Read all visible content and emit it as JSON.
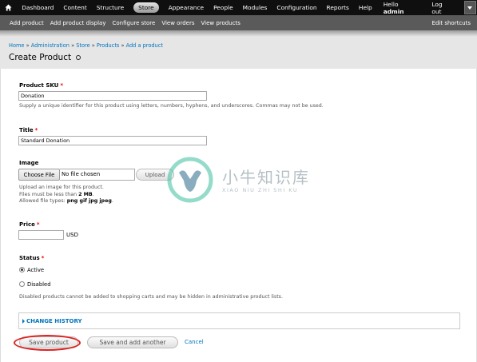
{
  "toolbar": {
    "items": [
      "Dashboard",
      "Content",
      "Structure",
      "Store",
      "Appearance",
      "People",
      "Modules",
      "Configuration",
      "Reports",
      "Help"
    ],
    "active": "Store",
    "hello_prefix": "Hello ",
    "user": "admin",
    "logout": "Log out"
  },
  "shortcuts": {
    "items": [
      "Add product",
      "Add product display",
      "Configure store",
      "View orders",
      "View products"
    ],
    "edit": "Edit shortcuts"
  },
  "breadcrumb": [
    "Home",
    "Administration",
    "Store",
    "Products",
    "Add a product"
  ],
  "page_title": "Create Product",
  "form": {
    "sku": {
      "label": "Product SKU",
      "required": "*",
      "value": "Donation",
      "description": "Supply a unique identifier for this product using letters, numbers, hyphens, and underscores. Commas may not be used."
    },
    "title": {
      "label": "Title",
      "required": "*",
      "value": "Standard Donation"
    },
    "image": {
      "label": "Image",
      "choose_file": "Choose File",
      "no_file": "No file chosen",
      "upload": "Upload",
      "desc1": "Upload an image for this product.",
      "desc2_prefix": "Files must be less than ",
      "desc2_size": "2 MB",
      "desc2_suffix": ".",
      "desc3_prefix": "Allowed file types: ",
      "desc3_types": "png gif jpg jpeg",
      "desc3_suffix": "."
    },
    "price": {
      "label": "Price",
      "required": "*",
      "value": "",
      "currency": "USD"
    },
    "status": {
      "label": "Status",
      "required": "*",
      "options": [
        "Active",
        "Disabled"
      ],
      "selected": "Active",
      "description": "Disabled products cannot be added to shopping carts and may be hidden in administrative product lists."
    },
    "change_history": "CHANGE HISTORY",
    "buttons": {
      "save": "Save product",
      "save_add": "Save and add another",
      "cancel": "Cancel"
    }
  },
  "watermark": {
    "title": "小牛知识库",
    "subtitle": "XIAO NIU ZHI SHI KU"
  },
  "colors": {
    "toolbar": "#0f0f0f",
    "shortcuts": "#5a5a5a",
    "link": "#0074bd",
    "required": "#ee0000",
    "highlight": "#dd2222"
  }
}
